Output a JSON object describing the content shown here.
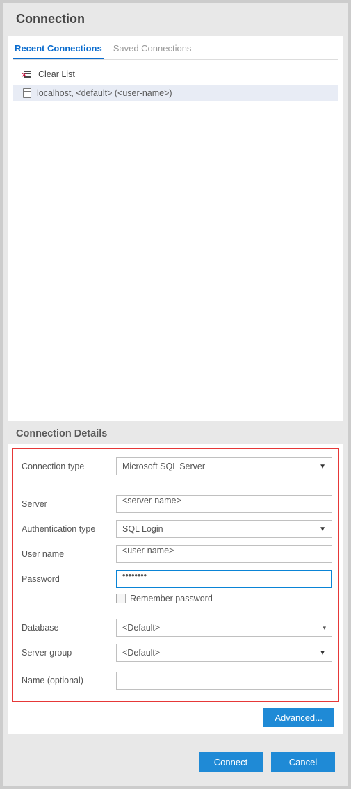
{
  "header": {
    "title": "Connection"
  },
  "tabs": {
    "recent": "Recent Connections",
    "saved": "Saved Connections"
  },
  "clear_list_label": "Clear List",
  "connections": [
    {
      "text": "localhost, <default> (<user-name>)"
    }
  ],
  "details": {
    "title": "Connection Details",
    "fields": {
      "connection_type": {
        "label": "Connection type",
        "value": "Microsoft SQL Server"
      },
      "server": {
        "label": "Server",
        "value": "<server-name>"
      },
      "auth_type": {
        "label": "Authentication type",
        "value": "SQL Login"
      },
      "username": {
        "label": "User name",
        "value": "<user-name>"
      },
      "password": {
        "label": "Password",
        "value": "••••••••"
      },
      "remember": {
        "label": "Remember password"
      },
      "database": {
        "label": "Database",
        "value": "<Default>"
      },
      "server_group": {
        "label": "Server group",
        "value": "<Default>"
      },
      "name": {
        "label": "Name (optional)",
        "value": ""
      }
    }
  },
  "buttons": {
    "advanced": "Advanced...",
    "connect": "Connect",
    "cancel": "Cancel"
  }
}
